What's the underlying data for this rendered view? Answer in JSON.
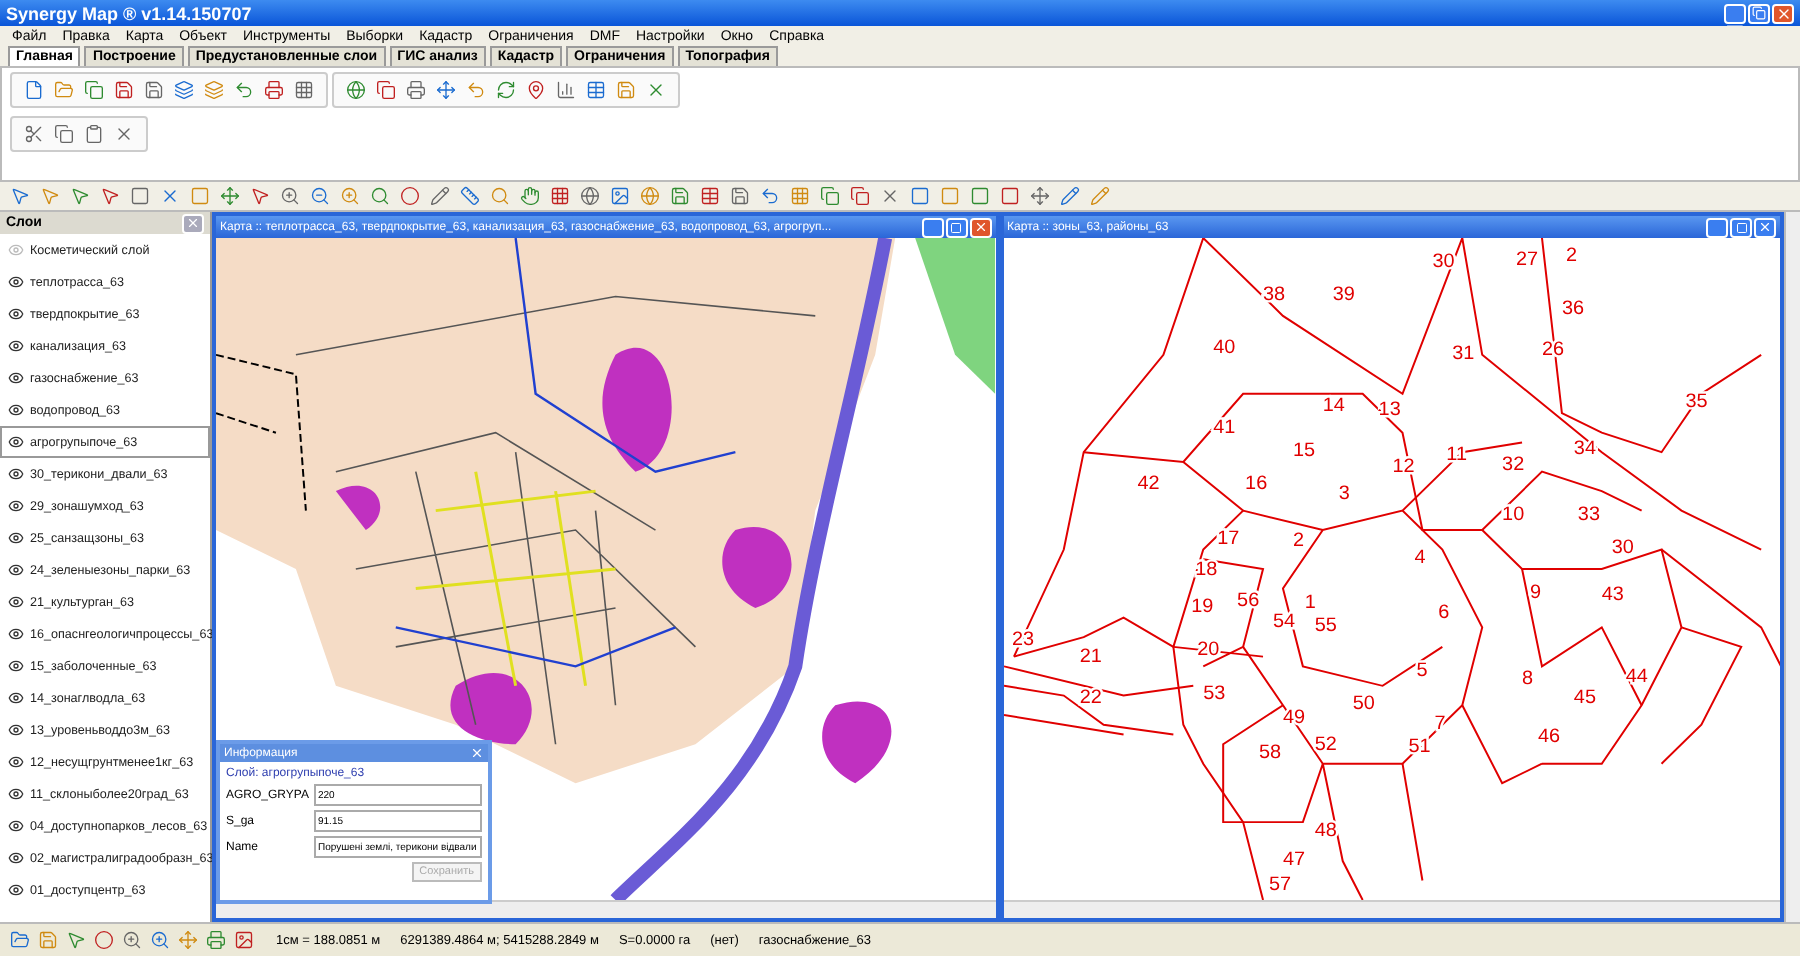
{
  "window": {
    "title": "Synergy Map ® v1.14.150707"
  },
  "menu": [
    "Файл",
    "Правка",
    "Карта",
    "Объект",
    "Инструменты",
    "Выборки",
    "Кадастр",
    "Ограничения",
    "DMF",
    "Настройки",
    "Окно",
    "Справка"
  ],
  "tabs": [
    {
      "label": "Главная",
      "selected": true
    },
    {
      "label": "Построение",
      "selected": false
    },
    {
      "label": "Предустановленные слои",
      "selected": false
    },
    {
      "label": "ГИС анализ",
      "selected": false
    },
    {
      "label": "Кадастр",
      "selected": false
    },
    {
      "label": "Ограничения",
      "selected": false
    },
    {
      "label": "Топография",
      "selected": false
    }
  ],
  "layers_panel": {
    "title": "Слои",
    "items": [
      {
        "name": "Косметический слой",
        "visible": false,
        "selected": false
      },
      {
        "name": "теплотрасса_63",
        "visible": true,
        "selected": false
      },
      {
        "name": "твердпокрытие_63",
        "visible": true,
        "selected": false
      },
      {
        "name": "канализация_63",
        "visible": true,
        "selected": false
      },
      {
        "name": "газоснабжение_63",
        "visible": true,
        "selected": false
      },
      {
        "name": "водопровод_63",
        "visible": true,
        "selected": false
      },
      {
        "name": "агрогрупыпоче_63",
        "visible": true,
        "selected": true
      },
      {
        "name": "30_терикони_двали_63",
        "visible": true,
        "selected": false
      },
      {
        "name": "29_зонашумход_63",
        "visible": true,
        "selected": false
      },
      {
        "name": "25_санзащзоны_63",
        "visible": true,
        "selected": false
      },
      {
        "name": "24_зеленыезоны_парки_63",
        "visible": true,
        "selected": false
      },
      {
        "name": "21_культурган_63",
        "visible": true,
        "selected": false
      },
      {
        "name": "16_опаснгеологичпроцессы_63",
        "visible": true,
        "selected": false
      },
      {
        "name": "15_заболоченные_63",
        "visible": true,
        "selected": false
      },
      {
        "name": "14_зонаглводла_63",
        "visible": true,
        "selected": false
      },
      {
        "name": "13_уровеньводдо3м_63",
        "visible": true,
        "selected": false
      },
      {
        "name": "12_несущгрунтменее1кг_63",
        "visible": true,
        "selected": false
      },
      {
        "name": "11_склоныболее20град_63",
        "visible": true,
        "selected": false
      },
      {
        "name": "04_доступнопарков_лесов_63",
        "visible": true,
        "selected": false
      },
      {
        "name": "02_магистралиградообразн_63",
        "visible": true,
        "selected": false
      },
      {
        "name": "01_доступцентр_63",
        "visible": true,
        "selected": false
      }
    ]
  },
  "map_windows": [
    {
      "title": "Карта :: теплотрасса_63, твердпокрытие_63, канализация_63, газоснабжение_63, водопровод_63, агрогруп...",
      "kind": "utilities"
    },
    {
      "title": "Карта :: зоны_63, районы_63",
      "kind": "zones",
      "zone_labels": [
        "30",
        "27",
        "2",
        "36",
        "38",
        "39",
        "40",
        "31",
        "26",
        "35",
        "41",
        "14",
        "13",
        "12",
        "11",
        "34",
        "42",
        "16",
        "15",
        "3",
        "32",
        "10",
        "33",
        "30",
        "17",
        "2",
        "4",
        "18",
        "19",
        "56",
        "1",
        "6",
        "9",
        "43",
        "20",
        "54",
        "55",
        "23",
        "21",
        "22",
        "53",
        "49",
        "50",
        "5",
        "7",
        "8",
        "45",
        "44",
        "46",
        "52",
        "51",
        "58",
        "48",
        "47",
        "57"
      ]
    }
  ],
  "info_panel": {
    "title": "Информация",
    "layer": "Слой: агрогрупыпоче_63",
    "fields": [
      {
        "label": "AGRO_GRYPA",
        "value": "220"
      },
      {
        "label": "S_ga",
        "value": "91.15"
      },
      {
        "label": "Name",
        "value": "Порушені землі, терикони відвали"
      }
    ],
    "save_button": {
      "label": "Сохранить",
      "disabled": true
    }
  },
  "status_bar": {
    "scale": "1см = 188.0851 м",
    "coordinates": "6291389.4864 м; 5415288.2849 м",
    "area": "S=0.0000 га",
    "style": "(нет)",
    "layer": "газоснабжение_63"
  }
}
